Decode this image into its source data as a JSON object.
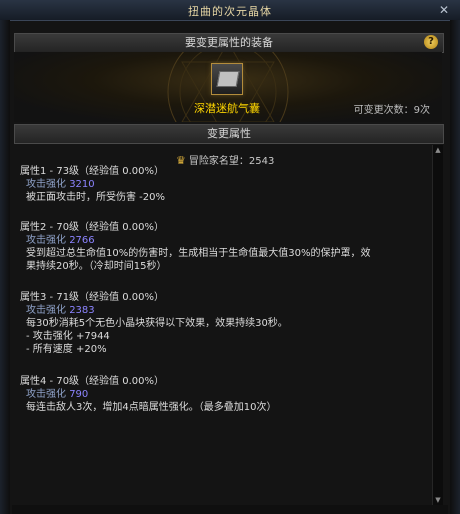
{
  "window": {
    "title": "扭曲的次元晶体",
    "close_icon": "close-icon"
  },
  "equip_section": {
    "header": "要变更属性的装备",
    "help_label": "?",
    "item_name": "深潜迷航气囊",
    "change_count": "可变更次数：9次"
  },
  "change_section": {
    "header": "变更属性",
    "fame": "冒险家名望：2543"
  },
  "attributes": [
    {
      "title": "属性1 - 73级（经验值 0.00%）",
      "stat_name": "攻击强化",
      "stat_value": "3210",
      "desc": [
        "被正面攻击时，所受伤害 -20%"
      ]
    },
    {
      "title": "属性2 - 70级（经验值 0.00%）",
      "stat_name": "攻击强化",
      "stat_value": "2766",
      "desc": [
        "受到超过总生命值10%的伤害时，生成相当于生命值最大值30%的保护罩，效",
        "果持续20秒。（冷却时间15秒）"
      ]
    },
    {
      "title": "属性3 - 71级（经验值 0.00%）",
      "stat_name": "攻击强化",
      "stat_value": "2383",
      "desc": [
        "每30秒消耗5个无色小晶块获得以下效果，效果持续30秒。",
        "- 攻击强化 +7944",
        "- 所有速度 +20%"
      ]
    },
    {
      "title": "属性4 - 70级（经验值 0.00%）",
      "stat_name": "攻击强化",
      "stat_value": "790",
      "desc": [
        "每连击敌人3次，增加4点暗属性强化。（最多叠加10次）"
      ]
    }
  ]
}
